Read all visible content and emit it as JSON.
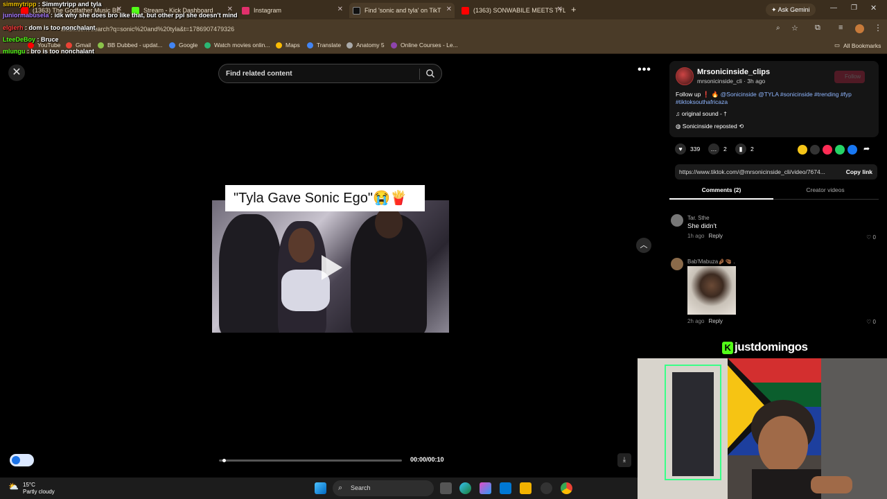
{
  "browser": {
    "tabs": [
      {
        "label": "(1363) The Godfather Music BE",
        "color": "#ff0000"
      },
      {
        "label": "Stream - Kick Dashboard",
        "color": "#53fc18"
      },
      {
        "label": "Instagram",
        "color": "#e1306c"
      },
      {
        "label": "Find 'sonic and tyla' on TikT",
        "color": "#111111"
      },
      {
        "label": "(1363) SONWABILE MEETS TYL",
        "color": "#ff0000"
      }
    ],
    "ask_gemini": "Ask Gemini",
    "url": "tiktok.com/search?q=sonic%20and%20tyla&t=1786907479326",
    "bookmarks": [
      "YouTube",
      "Gmail",
      "BB Dubbed - updat...",
      "Google",
      "Watch movies onlin...",
      "Maps",
      "Translate",
      "Anatomy 5",
      "Online Courses - Le..."
    ],
    "all_bookmarks": "All Bookmarks"
  },
  "chat_overlay": [
    {
      "user": "simmytripp",
      "text": "Simmytripp and tyla",
      "color": "#f2c200"
    },
    {
      "user": "juniormabusela",
      "text": "idk why she does bro like that, but other ppl she doesn't mind",
      "color": "#a77bff"
    },
    {
      "user": "elgierh",
      "text": "dom is too nonchalant",
      "color": "#ff3b3b"
    },
    {
      "user": "LteeDeBoy",
      "text": "Bruce",
      "color": "#53fc18"
    },
    {
      "user": "mlungu",
      "text": "bro is too nonchalant",
      "color": "#53fc18"
    }
  ],
  "search": {
    "placeholder": "Find related content"
  },
  "video": {
    "caption": "\"Tyla Gave Sonic Ego\"😭🍟",
    "time": "00:00/00:10",
    "progress": 0.02
  },
  "post": {
    "username": "Mrsonicinside_clips",
    "handle": "mrsonicinside_cli · 3h ago",
    "follow_label": "Follow",
    "desc_prefix": "Follow up ❗ 🔥",
    "desc_tags": "@Sonicinside @TYLA #sonicinside #trending #fyp #tiktoksouthafricaza",
    "sound": "original sound - †",
    "reposted": "Sonicinside reposted",
    "likes": "339",
    "comments": "2",
    "saves": "2",
    "link": "https://www.tiktok.com/@mrsonicinside_cli/video/7674...",
    "copy_link": "Copy link",
    "tab_comments": "Comments (2)",
    "tab_creator": "Creator videos"
  },
  "comments": [
    {
      "user": "Tar. Sthe",
      "text": "She didn't",
      "time": "1h ago",
      "reply": "Reply",
      "likes": "0"
    },
    {
      "user": "Bab'Mabuza🤌🏾🤏🏾 .",
      "text": "",
      "time": "2h ago",
      "reply": "Reply",
      "likes": "0"
    }
  ],
  "stream": {
    "channel": "justdomingos"
  },
  "taskbar": {
    "temp": "15°C",
    "weather": "Partly cloudy",
    "search": "Search"
  }
}
